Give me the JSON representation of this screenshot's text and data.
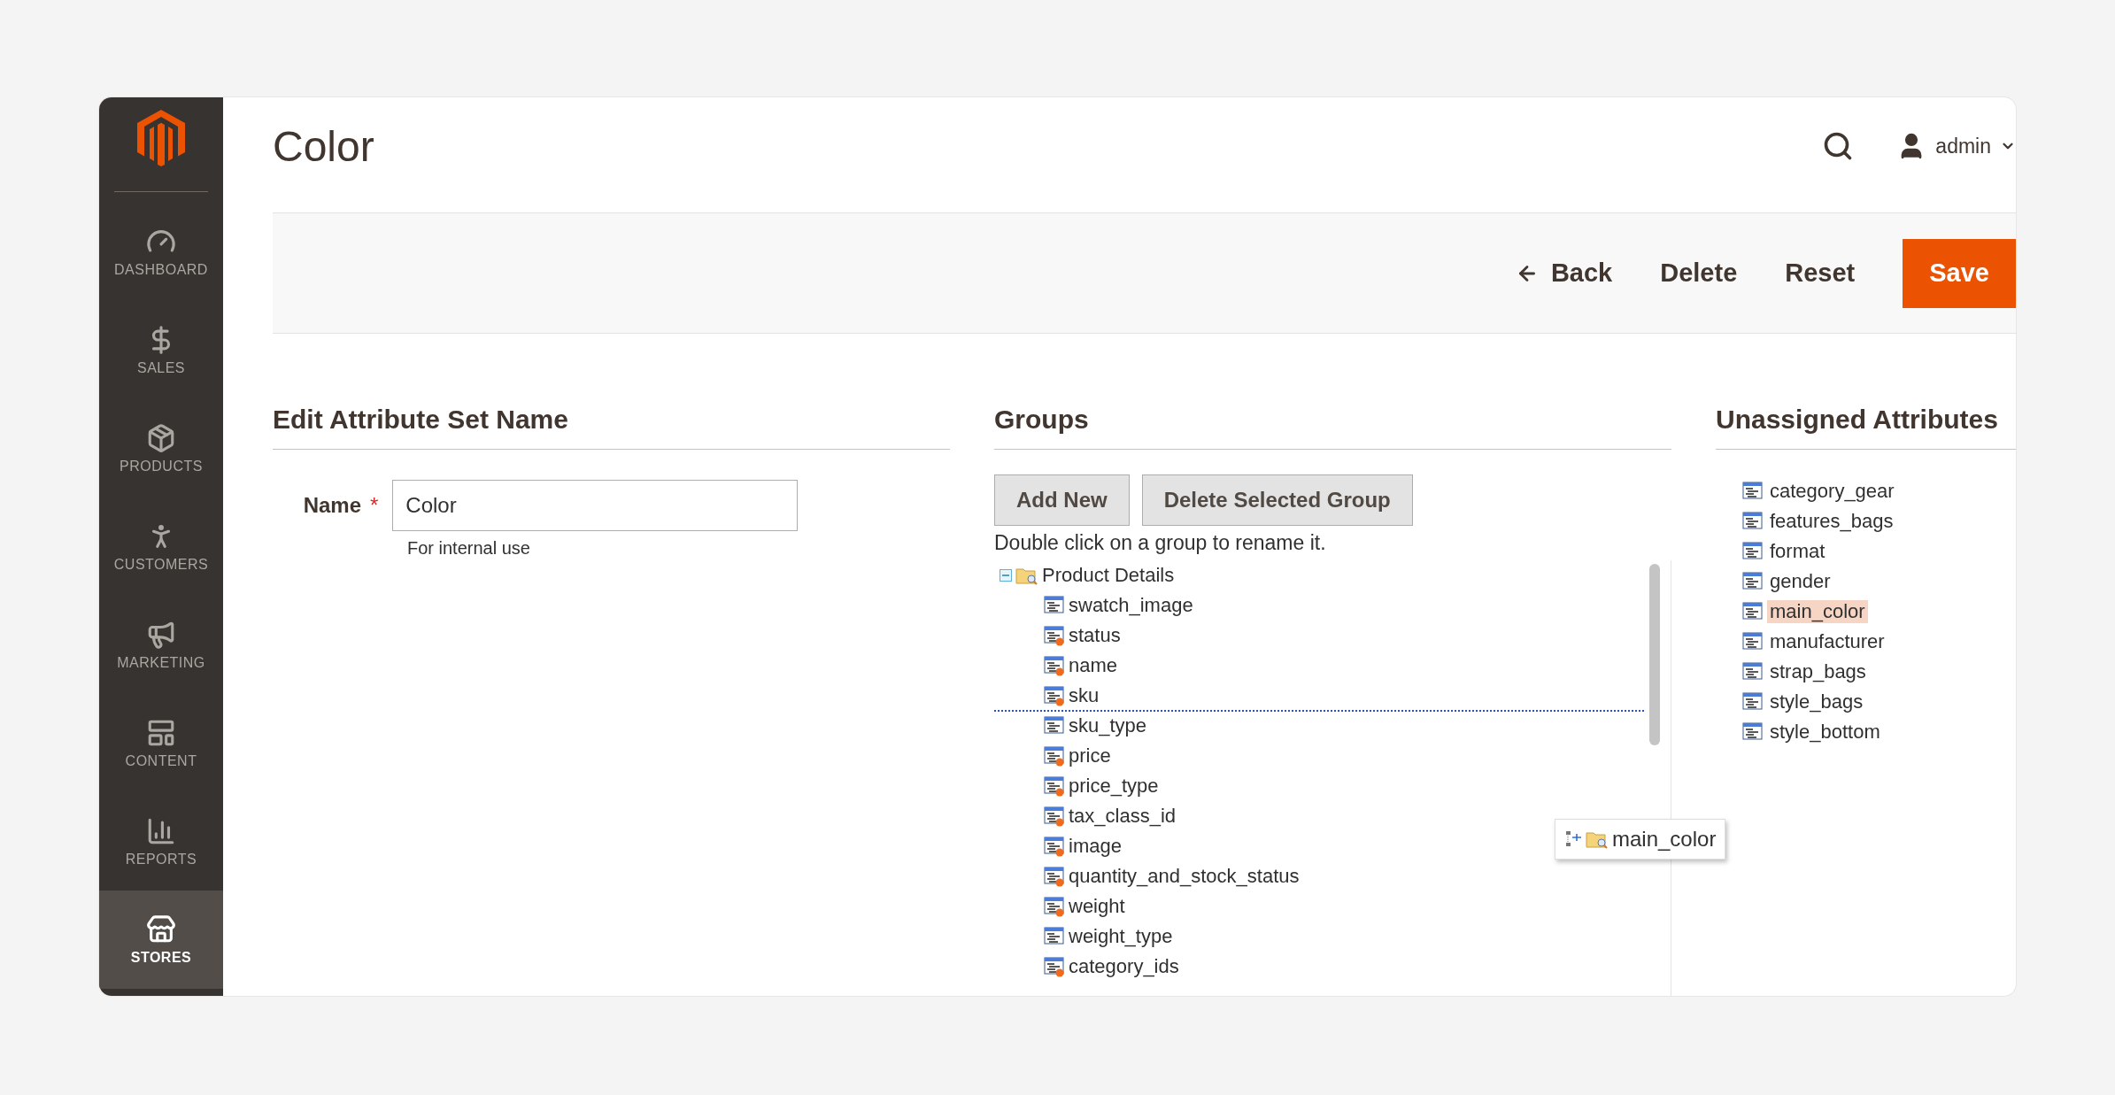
{
  "sidebar": {
    "items": [
      {
        "label": "DASHBOARD",
        "selected": false
      },
      {
        "label": "SALES",
        "selected": false
      },
      {
        "label": "PRODUCTS",
        "selected": false
      },
      {
        "label": "CUSTOMERS",
        "selected": false
      },
      {
        "label": "MARKETING",
        "selected": false
      },
      {
        "label": "CONTENT",
        "selected": false
      },
      {
        "label": "REPORTS",
        "selected": false
      },
      {
        "label": "STORES",
        "selected": true
      }
    ]
  },
  "header": {
    "title": "Color",
    "user": "admin"
  },
  "actions": [
    {
      "label": "Back",
      "kind": "back"
    },
    {
      "label": "Delete",
      "kind": "plain"
    },
    {
      "label": "Reset",
      "kind": "plain"
    },
    {
      "label": "Save",
      "kind": "primary"
    }
  ],
  "edit_section": {
    "heading": "Edit Attribute Set Name",
    "name_field": {
      "label": "Name",
      "required_mark": "*",
      "value": "Color",
      "note": "For internal use"
    }
  },
  "groups": {
    "heading": "Groups",
    "buttons": [
      "Add New",
      "Delete Selected Group"
    ],
    "hint": "Double click on a group to rename it.",
    "tree": [
      {
        "label": "Product Details",
        "expanded": true,
        "children": [
          {
            "label": "swatch_image",
            "kind": "custom",
            "drop_below": false
          },
          {
            "label": "status",
            "kind": "system",
            "drop_below": false
          },
          {
            "label": "name",
            "kind": "system",
            "drop_below": false
          },
          {
            "label": "sku",
            "kind": "system",
            "drop_below": true
          },
          {
            "label": "sku_type",
            "kind": "custom",
            "drop_below": false
          },
          {
            "label": "price",
            "kind": "system",
            "drop_below": false
          },
          {
            "label": "price_type",
            "kind": "system",
            "drop_below": false
          },
          {
            "label": "tax_class_id",
            "kind": "system",
            "drop_below": false
          },
          {
            "label": "image",
            "kind": "system",
            "drop_below": false
          },
          {
            "label": "quantity_and_stock_status",
            "kind": "system",
            "drop_below": false
          },
          {
            "label": "weight",
            "kind": "system",
            "drop_below": false
          },
          {
            "label": "weight_type",
            "kind": "custom",
            "drop_below": false
          },
          {
            "label": "category_ids",
            "kind": "system",
            "drop_below": false
          }
        ]
      }
    ],
    "drag_item": {
      "label": "main_color"
    }
  },
  "unassigned": {
    "heading": "Unassigned Attributes",
    "items": [
      {
        "label": "category_gear",
        "selected": false
      },
      {
        "label": "features_bags",
        "selected": false
      },
      {
        "label": "format",
        "selected": false
      },
      {
        "label": "gender",
        "selected": false
      },
      {
        "label": "main_color",
        "selected": true
      },
      {
        "label": "manufacturer",
        "selected": false
      },
      {
        "label": "strap_bags",
        "selected": false
      },
      {
        "label": "style_bags",
        "selected": false
      },
      {
        "label": "style_bottom",
        "selected": false
      }
    ]
  }
}
